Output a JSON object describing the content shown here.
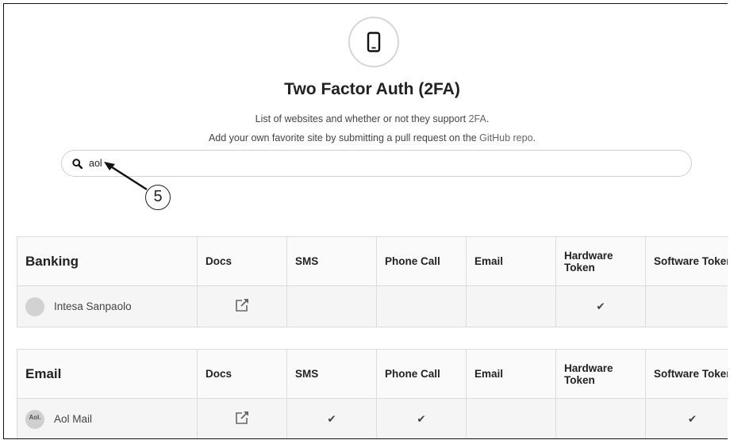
{
  "header": {
    "title": "Two Factor Auth (2FA)",
    "subtitle_prefix": "List of websites and whether or not they support ",
    "subtitle_link": "2FA",
    "subtitle_suffix": ".",
    "subtitle2_prefix": "Add your own favorite site by submitting a pull request on the ",
    "subtitle2_link": "GitHub repo",
    "subtitle2_suffix": "."
  },
  "search": {
    "value": "aol"
  },
  "annotation": {
    "number": "5"
  },
  "columns": [
    "Docs",
    "SMS",
    "Phone Call",
    "Email",
    "Hardware Token",
    "Software Token"
  ],
  "sections": [
    {
      "category": "Banking",
      "headers": {
        "docs": "Docs",
        "sms": "SMS",
        "phone": "Phone Call",
        "email": "Email",
        "hardware": "Hardware Token",
        "software": "Software Token"
      },
      "rows": [
        {
          "name": "Intesa Sanpaolo",
          "docs_icon": "external-link-icon",
          "sms": "",
          "phone": "",
          "email": "",
          "hardware": "✔",
          "software": ""
        }
      ]
    },
    {
      "category": "Email",
      "headers": {
        "docs": "Docs",
        "sms": "SMS",
        "phone": "Phone Call",
        "email": "Email",
        "hardware": "Hardware Token",
        "software": "Software Token"
      },
      "rows": [
        {
          "name": "Aol Mail",
          "logo_text": "Aol.",
          "docs_icon": "external-link-icon",
          "sms": "✔",
          "phone": "✔",
          "email": "",
          "hardware": "",
          "software": "✔"
        }
      ]
    }
  ],
  "icons": {
    "header": "mobile-phone-icon",
    "search": "search-icon",
    "check": "checkmark-icon"
  },
  "colors": {
    "border": "#dcdcdc",
    "row_bg": "#f5f5f5",
    "text": "#222222"
  }
}
